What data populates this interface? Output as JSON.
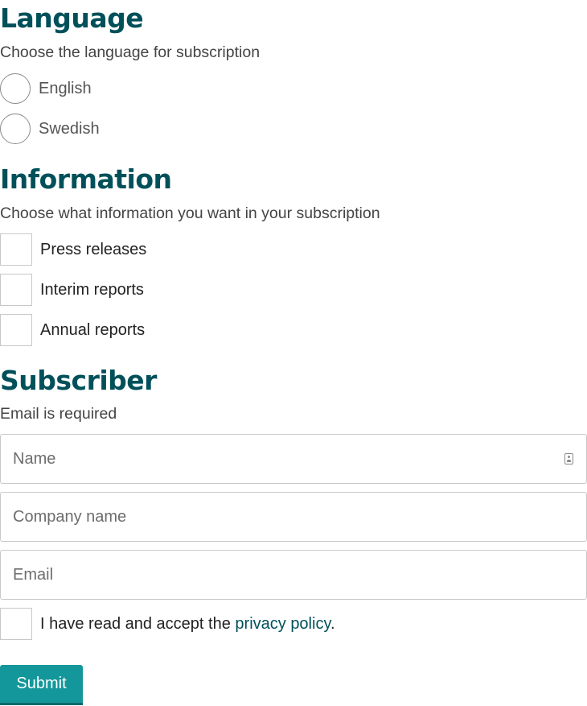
{
  "language": {
    "title": "Language",
    "description": "Choose the language for subscription",
    "options": [
      {
        "label": "English",
        "selected": false
      },
      {
        "label": "Swedish",
        "selected": false
      }
    ]
  },
  "information": {
    "title": "Information",
    "description": "Choose what information you want in your subscription",
    "options": [
      {
        "label": "Press releases",
        "checked": false
      },
      {
        "label": "Interim reports",
        "checked": false
      },
      {
        "label": "Annual reports",
        "checked": false
      }
    ]
  },
  "subscriber": {
    "title": "Subscriber",
    "description": "Email is required",
    "fields": {
      "name": {
        "placeholder": "Name",
        "value": "",
        "icon": "contact-card-icon"
      },
      "company": {
        "placeholder": "Company name",
        "value": ""
      },
      "email": {
        "placeholder": "Email",
        "value": ""
      }
    },
    "consent": {
      "text_before": "I have read and accept the ",
      "link_text": "privacy policy",
      "text_after": ".",
      "checked": false
    },
    "submit_label": "Submit"
  },
  "colors": {
    "heading": "#00505a",
    "button": "#14979a",
    "link": "#00505a"
  }
}
